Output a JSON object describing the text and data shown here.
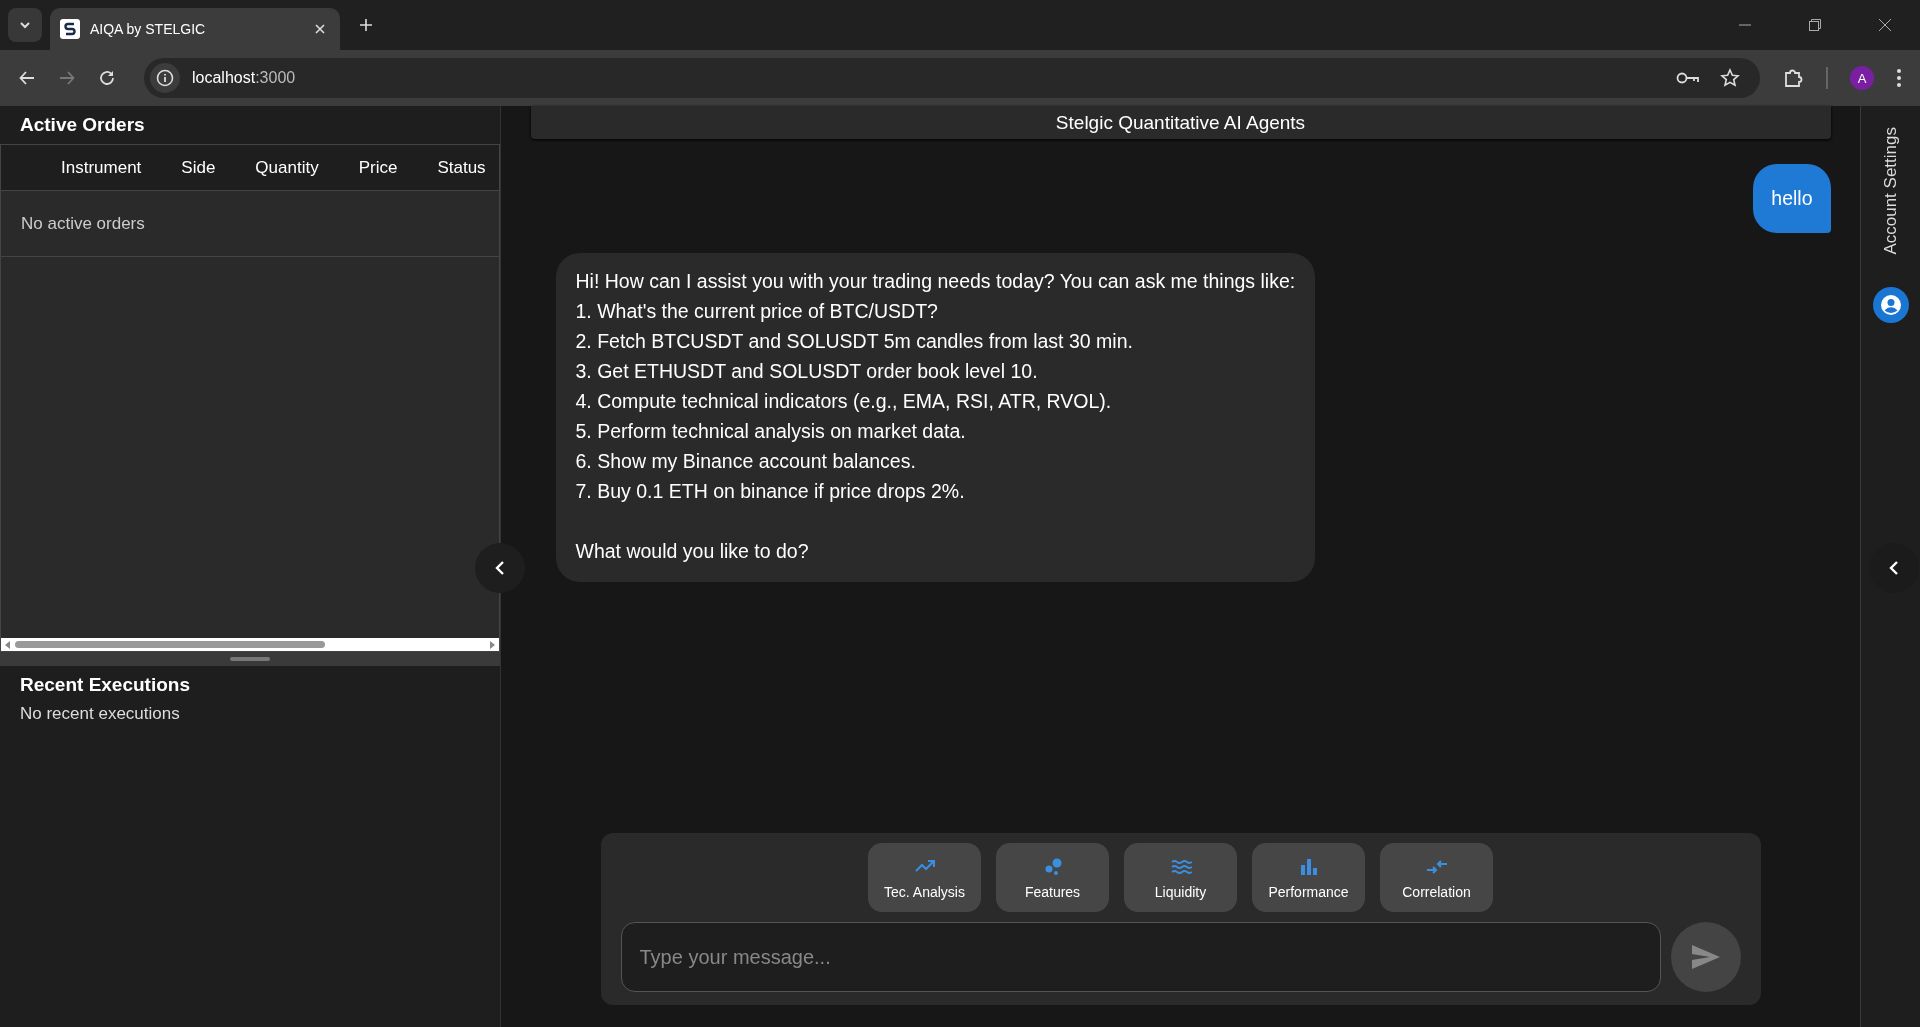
{
  "browser": {
    "tab": {
      "title": "AIQA by STELGIC",
      "selected": true
    },
    "url": {
      "host": "localhost",
      "port": ":3000"
    },
    "profile": "A"
  },
  "active_orders": {
    "title": "Active Orders",
    "columns": [
      "Instrument",
      "Side",
      "Quantity",
      "Price",
      "Status"
    ],
    "empty_text": "No active orders"
  },
  "recent_executions": {
    "title": "Recent Executions",
    "empty_text": "No recent executions"
  },
  "chat": {
    "header": "Stelgic Quantitative AI Agents",
    "messages": [
      {
        "kind": "user",
        "text": "hello"
      },
      {
        "kind": "assistant",
        "text": "Hi! How can I assist you with your trading needs today? You can ask me things like:\n1. What's the current price of BTC/USDT?\n2. Fetch BTCUSDT and SOLUSDT 5m candles from last 30 min.\n3. Get ETHUSDT and SOLUSDT order book level 10.\n4. Compute technical indicators (e.g., EMA, RSI, ATR, RVOL).\n5. Perform technical analysis on market data.\n6. Show my Binance account balances.\n7. Buy 0.1 ETH on binance if price drops 2%.\n\nWhat would you like to do?"
      }
    ],
    "quick_actions": [
      "Tec. Analysis",
      "Features",
      "Liquidity",
      "Performance",
      "Correlation"
    ],
    "input": {
      "placeholder": "Type your message..."
    }
  },
  "right_sidebar": {
    "label": "Account Settings"
  }
}
